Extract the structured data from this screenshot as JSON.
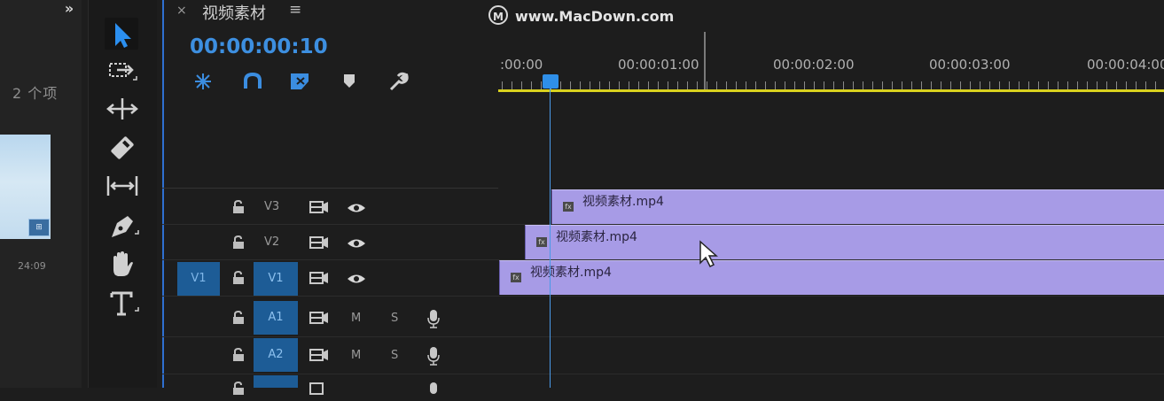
{
  "project": {
    "collapse_label": "»",
    "item_count": "2 个项",
    "clip_duration": "24:09",
    "thumb_badge": "⊞"
  },
  "tools": [
    {
      "name": "selection-tool-icon"
    },
    {
      "name": "track-select-tool-icon"
    },
    {
      "name": "ripple-edit-tool-icon"
    },
    {
      "name": "razor-tool-icon"
    },
    {
      "name": "slip-tool-icon"
    },
    {
      "name": "pen-tool-icon"
    },
    {
      "name": "hand-tool-icon"
    },
    {
      "name": "type-tool-icon"
    }
  ],
  "timeline": {
    "close_label": "×",
    "sequence_name": "视频素材",
    "menu_label": "≡",
    "timecode": "00:00:00:10",
    "ruler_labels": [
      ":00:00",
      "00:00:01:00",
      "00:00:02:00",
      "00:00:03:00",
      "00:00:04:00"
    ],
    "tools": [
      "snap-icon",
      "linked-selection-icon",
      "add-marker-icon",
      "marker-icon",
      "wrench-icon"
    ]
  },
  "watermark": {
    "logo": "M",
    "text": "www.MacDown.com"
  },
  "tracks": {
    "video": [
      {
        "name": "V3",
        "source": "",
        "clip": "视频素材.mp4"
      },
      {
        "name": "V2",
        "source": "",
        "clip": "视频素材.mp4"
      },
      {
        "name": "V1",
        "source": "V1",
        "clip": "视频素材.mp4"
      }
    ],
    "audio": [
      {
        "name": "A1",
        "mute": "M",
        "solo": "S"
      },
      {
        "name": "A2",
        "mute": "M",
        "solo": "S"
      }
    ]
  },
  "colors": {
    "accent": "#2f8fe8",
    "timecode": "#3d8fe0",
    "clip": "#a79be6",
    "ruler": "#d9d21e",
    "track_target": "#1d5c96"
  }
}
